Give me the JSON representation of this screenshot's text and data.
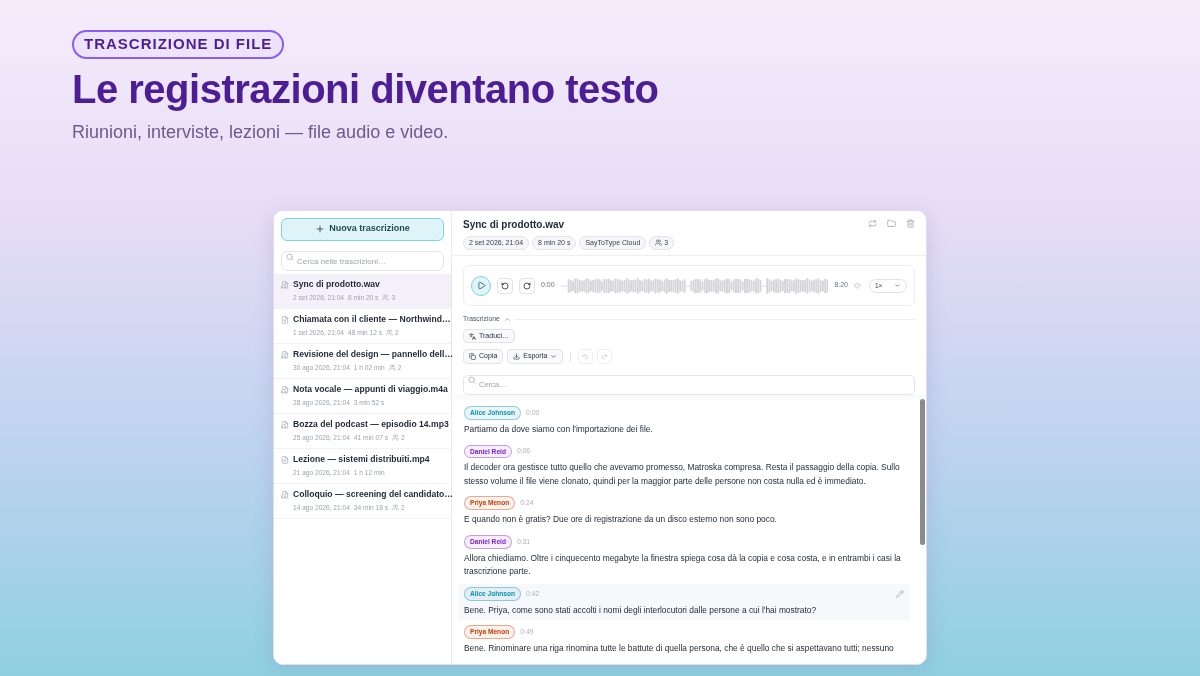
{
  "header": {
    "badge": "TRASCRIZIONE DI FILE",
    "title": "Le registrazioni diventano testo",
    "subtitle": "Riunioni, interviste, lezioni — file audio e video."
  },
  "sidebar": {
    "new_button": "Nuova trascrizione",
    "search_placeholder": "Cerca nelle trascrizioni…",
    "items": [
      {
        "kind": "audio",
        "title": "Sync di prodotto.wav",
        "date": "2 set 2026, 21:04",
        "duration": "8 min 20 s",
        "speakers": "3",
        "selected": true
      },
      {
        "kind": "video",
        "title": "Chiamata con il cliente — Northwind…",
        "date": "1 set 2026, 21:04",
        "duration": "48 min 12 s",
        "speakers": "2",
        "selected": false
      },
      {
        "kind": "audio",
        "title": "Revisione del design — pannello dell…",
        "date": "30 ago 2026, 21:04",
        "duration": "1 h 02 min",
        "speakers": "2",
        "selected": false
      },
      {
        "kind": "audio",
        "title": "Nota vocale — appunti di viaggio.m4a",
        "date": "28 ago 2026, 21:04",
        "duration": "3 min 52 s",
        "selected": false
      },
      {
        "kind": "audio",
        "title": "Bozza del podcast — episodio 14.mp3",
        "date": "25 ago 2026, 21:04",
        "duration": "41 min 07 s",
        "speakers": "2",
        "selected": false
      },
      {
        "kind": "video",
        "title": "Lezione — sistemi distribuiti.mp4",
        "date": "21 ago 2026, 21:04",
        "duration": "1 h 12 min",
        "selected": false
      },
      {
        "kind": "audio",
        "title": "Colloquio — screening del candidato…",
        "date": "14 ago 2026, 21:04",
        "duration": "34 min 18 s",
        "speakers": "2",
        "selected": false
      }
    ]
  },
  "detail": {
    "title": "Sync di prodotto.wav",
    "tags": [
      "2 set 2026, 21:04",
      "8 min 20 s",
      "SayToType Cloud"
    ],
    "speakers": "3",
    "player": {
      "current": "0:00",
      "total": "8:20",
      "speed": "1×"
    },
    "section_label": "Trascrizione",
    "translate": "Traduci…",
    "copy": "Copia",
    "export": "Esporta",
    "search_placeholder": "Cerca…",
    "segments": [
      {
        "speaker": "Alice Johnson",
        "color": "#0891b2",
        "time": "0:00",
        "text": "Partiamo da dove siamo con l'importazione dei file.",
        "selected": false
      },
      {
        "speaker": "Daniel Reid",
        "color": "#7e22ce",
        "time": "0:06",
        "text": "Il decoder ora gestisce tutto quello che avevamo promesso, Matroska compresa. Resta il passaggio della copia. Sullo stesso volume il file viene clonato, quindi per la maggior parte delle persone non costa nulla ed è immediato.",
        "selected": false
      },
      {
        "speaker": "Priya Menon",
        "color": "#c2410c",
        "time": "0:24",
        "text": "E quando non è gratis? Due ore di registrazione da un disco esterno non sono poco.",
        "selected": false
      },
      {
        "speaker": "Daniel Reid",
        "color": "#7e22ce",
        "time": "0:31",
        "text": "Allora chiediamo. Oltre i cinquecento megabyte la finestra spiega cosa dà la copia e cosa costa, e in entrambi i casi la trascrizione parte.",
        "selected": false
      },
      {
        "speaker": "Alice Johnson",
        "color": "#0891b2",
        "time": "0:42",
        "text": "Bene. Priya, come sono stati accolti i nomi degli interlocutori dalle persone a cui l'hai mostrato?",
        "selected": true
      },
      {
        "speaker": "Priya Menon",
        "color": "#c2410c",
        "time": "0:49",
        "text": "Bene. Rinominare una riga rinomina tutte le battute di quella persona, che è quello che si aspettavano tutti; nessuno",
        "selected": false
      }
    ]
  }
}
